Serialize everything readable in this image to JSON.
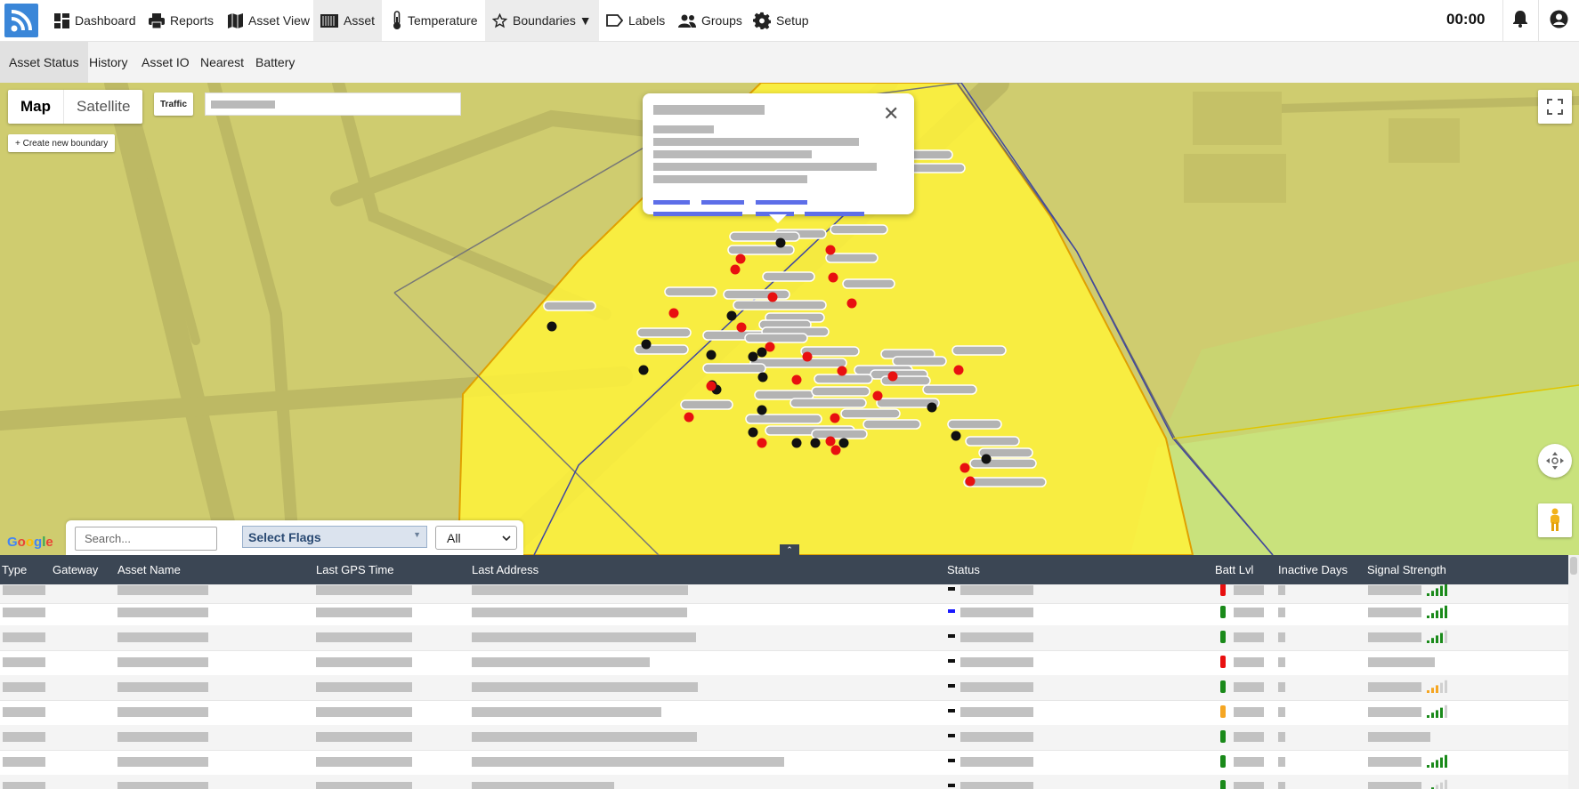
{
  "nav": {
    "items": [
      {
        "label": "Dashboard",
        "icon": "dashboard-icon"
      },
      {
        "label": "Reports",
        "icon": "printer-icon"
      },
      {
        "label": "Asset View",
        "icon": "map-icon"
      },
      {
        "label": "Asset",
        "icon": "container-icon"
      },
      {
        "label": "Temperature",
        "icon": "thermometer-icon"
      },
      {
        "label": "Boundaries ▼",
        "icon": "star-icon"
      },
      {
        "label": "Labels",
        "icon": "label-icon"
      },
      {
        "label": "Groups",
        "icon": "groups-icon"
      },
      {
        "label": "Setup",
        "icon": "gear-icon"
      }
    ],
    "clock": "00:00"
  },
  "subnav": {
    "items": [
      "Asset Status",
      "History",
      "Asset IO",
      "Nearest",
      "Battery"
    ]
  },
  "map": {
    "map_type_map": "Map",
    "map_type_satellite": "Satellite",
    "traffic": "Traffic",
    "create_boundary": "+ Create new boundary",
    "google": "Google"
  },
  "filters": {
    "search_placeholder": "Search...",
    "flags": "Select Flags",
    "all": "All"
  },
  "table": {
    "headers": [
      "Type",
      "Gateway",
      "Asset Name",
      "Last GPS Time",
      "Last Address",
      "Status",
      "Batt Lvl",
      "Inactive Days",
      "Signal Strength"
    ]
  },
  "colors": {
    "header_bg": "#3b4654",
    "boundary_fill": "#fff23a",
    "marker_red": "#e81010",
    "marker_black": "#111111",
    "batt_red": "#e81010",
    "batt_green": "#1a8a1a",
    "batt_orange": "#f5a623",
    "status_blue": "#1a1aff"
  }
}
